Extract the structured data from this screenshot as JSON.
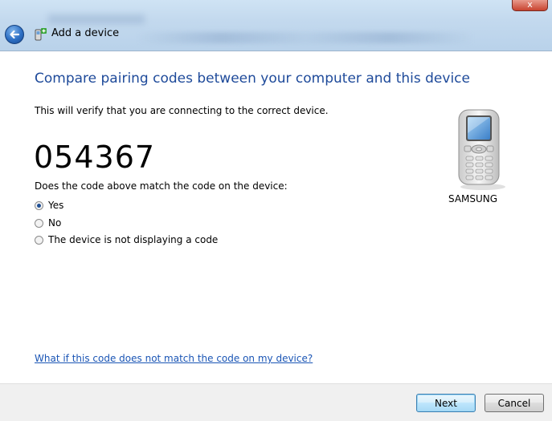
{
  "window": {
    "title": "Add a device",
    "close_glyph": "x"
  },
  "main": {
    "heading": "Compare pairing codes between your computer and this device",
    "subtext": "This will verify that you are connecting to the correct device.",
    "code": "054367",
    "question": "Does the code above match the code on the device:",
    "options": [
      {
        "label": "Yes",
        "selected": true
      },
      {
        "label": "No",
        "selected": false
      },
      {
        "label": "The device is not displaying a code",
        "selected": false
      }
    ],
    "device_name": "SAMSUNG",
    "help_link": "What if this code does not match the code on my device?"
  },
  "footer": {
    "next_label": "Next",
    "cancel_label": "Cancel"
  },
  "colors": {
    "heading": "#1e4a9a",
    "link": "#1a55b5",
    "titlebar": "#c3d9ee"
  }
}
